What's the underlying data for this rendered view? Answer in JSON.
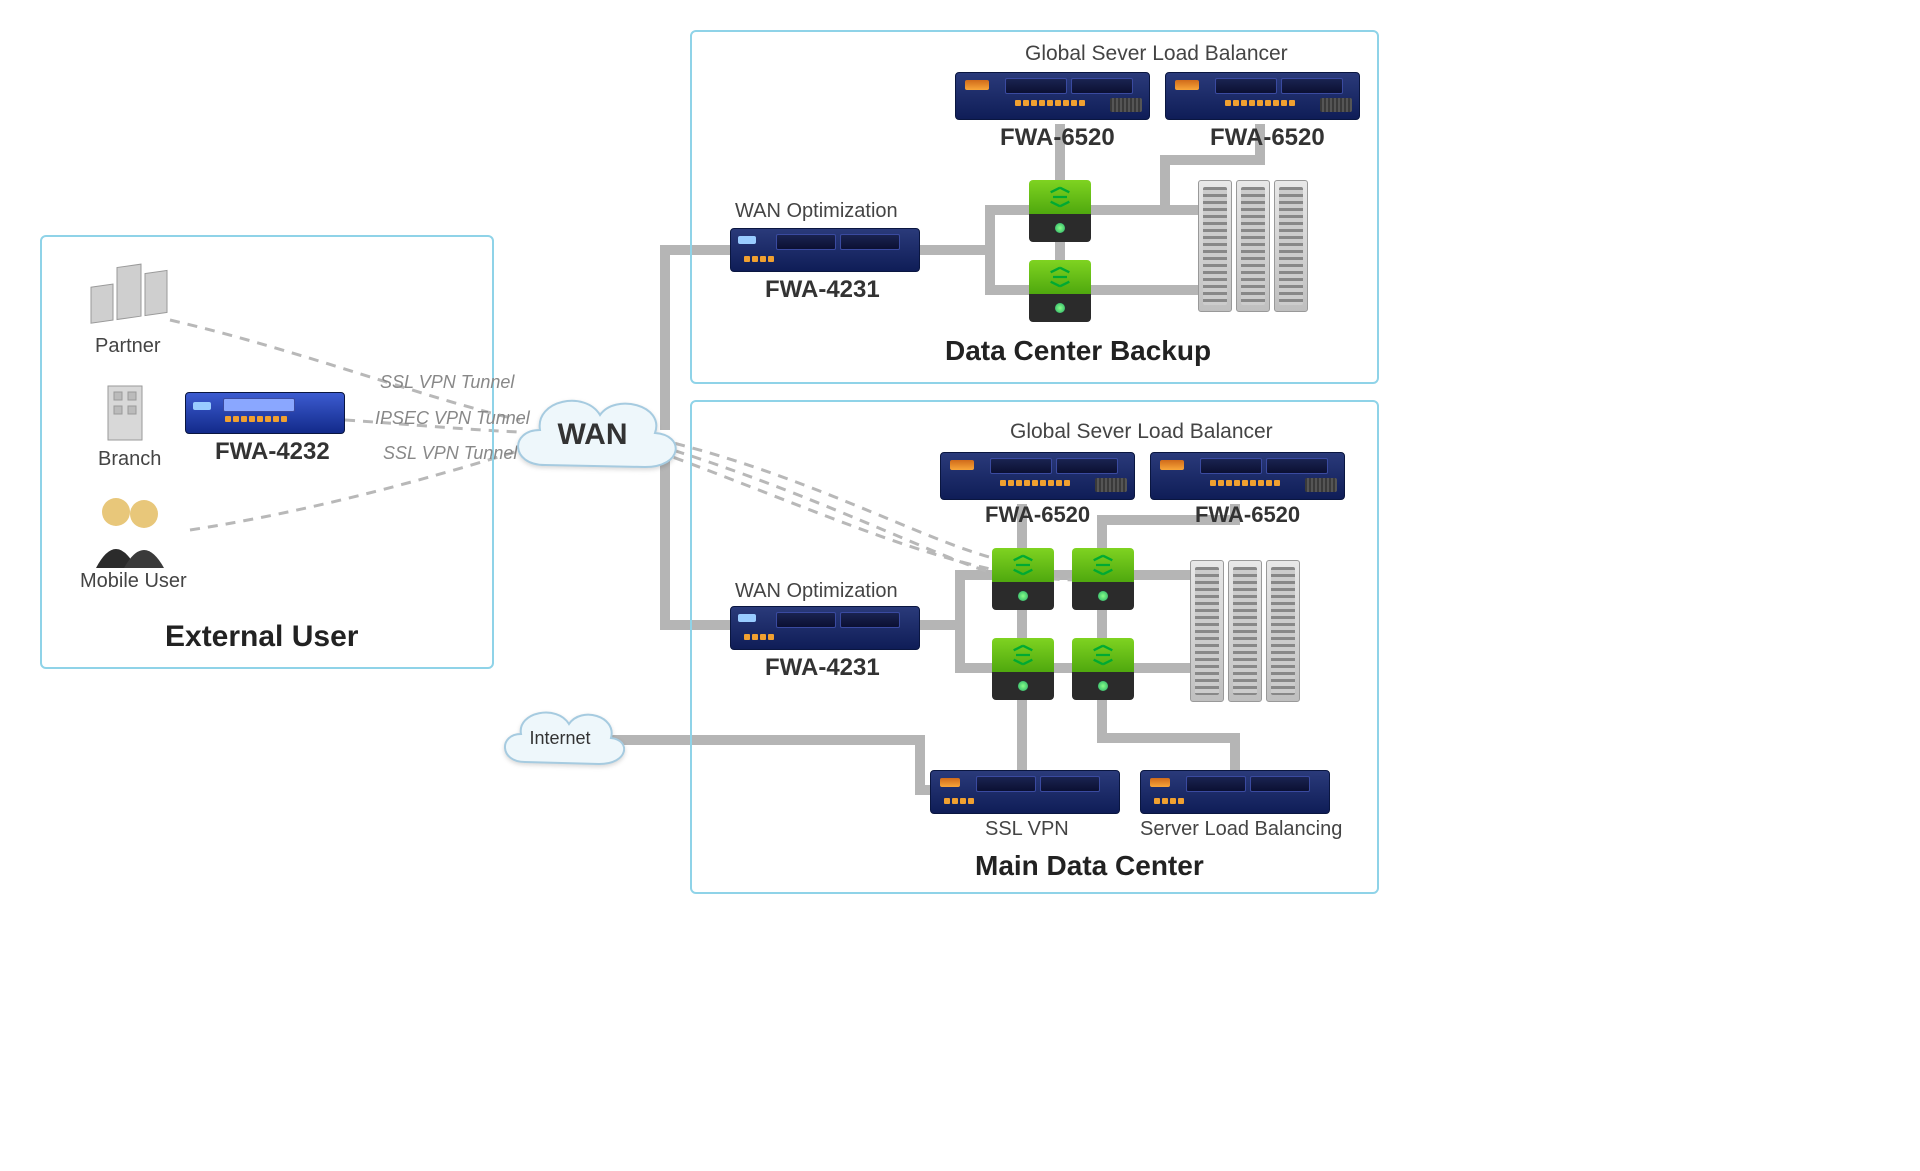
{
  "zones": {
    "external": {
      "title": "External User"
    },
    "backup": {
      "title": "Data Center Backup"
    },
    "main": {
      "title": "Main Data Center"
    }
  },
  "clouds": {
    "wan": "WAN",
    "internet": "Internet"
  },
  "external": {
    "partner": "Partner",
    "branch": "Branch",
    "mobile": "Mobile User",
    "branch_appliance": "FWA-4232"
  },
  "vpn_labels": {
    "ssl_top": "SSL VPN Tunnel",
    "ipsec": "IPSEC VPN Tunnel",
    "ssl_bot": "SSL VPN Tunnel"
  },
  "backup": {
    "gslb_title": "Global Sever Load Balancer",
    "fwa6520_a": "FWA-6520",
    "fwa6520_b": "FWA-6520",
    "wanopt_title": "WAN Optimization",
    "fwa4231": "FWA-4231"
  },
  "main": {
    "gslb_title": "Global Sever Load Balancer",
    "fwa6520_a": "FWA-6520",
    "fwa6520_b": "FWA-6520",
    "wanopt_title": "WAN Optimization",
    "fwa4231": "FWA-4231",
    "sslvpn": "SSL VPN",
    "slb": "Server Load Balancing"
  }
}
